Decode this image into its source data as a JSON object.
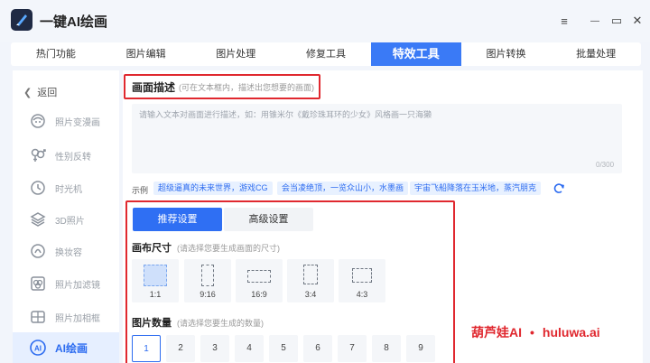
{
  "app": {
    "title": "一键AI绘画"
  },
  "window_controls": {
    "menu": "≡",
    "minimize": "—",
    "maximize": "▭",
    "close": "✕"
  },
  "tabs": [
    {
      "label": "热门功能"
    },
    {
      "label": "图片编辑"
    },
    {
      "label": "图片处理"
    },
    {
      "label": "修复工具"
    },
    {
      "label": "特效工具",
      "active": true
    },
    {
      "label": "图片转换"
    },
    {
      "label": "批量处理"
    }
  ],
  "sidebar": {
    "back_label": "返回",
    "items": [
      {
        "label": "照片变漫画",
        "icon": "cartoon-face-icon"
      },
      {
        "label": "性别反转",
        "icon": "gender-icon"
      },
      {
        "label": "时光机",
        "icon": "clock-icon"
      },
      {
        "label": "3D照片",
        "icon": "layers-icon"
      },
      {
        "label": "换妆容",
        "icon": "makeup-icon"
      },
      {
        "label": "照片加滤镜",
        "icon": "filter-icon"
      },
      {
        "label": "照片加相框",
        "icon": "frame-icon"
      },
      {
        "label": "AI绘画",
        "icon": "ai-icon",
        "active": true
      }
    ]
  },
  "description": {
    "title": "画面描述",
    "hint": "(可在文本框内，描述出您想要的画面)",
    "placeholder": "请输入文本对画面进行描述，如：用锥米尔《戴珍珠耳环的少女》风格画一只海獭",
    "counter": "0/300"
  },
  "examples": {
    "label": "示例",
    "chips": [
      "超级逼真的未来世界，游戏CG",
      "会当凌绝顶，一览众山小，水墨画",
      "宇宙飞船降落在玉米地，蒸汽朋克"
    ]
  },
  "settings": {
    "recommended_label": "推荐设置",
    "advanced_label": "高级设置",
    "canvas_title": "画布尺寸",
    "canvas_hint": "(请选择您要生成画面的尺寸)",
    "ratios": [
      "1:1",
      "9:16",
      "16:9",
      "3:4",
      "4:3"
    ],
    "selected_ratio": "1:1",
    "count_title": "图片数量",
    "count_hint": "(请选择您要生成的数量)",
    "counts": [
      "1",
      "2",
      "3",
      "4",
      "5",
      "6",
      "7",
      "8",
      "9"
    ],
    "selected_count": "1"
  },
  "watermark": {
    "left": "葫芦娃AI",
    "dot": "•",
    "right": "huluwa.ai"
  },
  "colors": {
    "accent": "#2f6ff3",
    "highlight_box": "#e0282f",
    "active_bg": "#e6efff"
  }
}
